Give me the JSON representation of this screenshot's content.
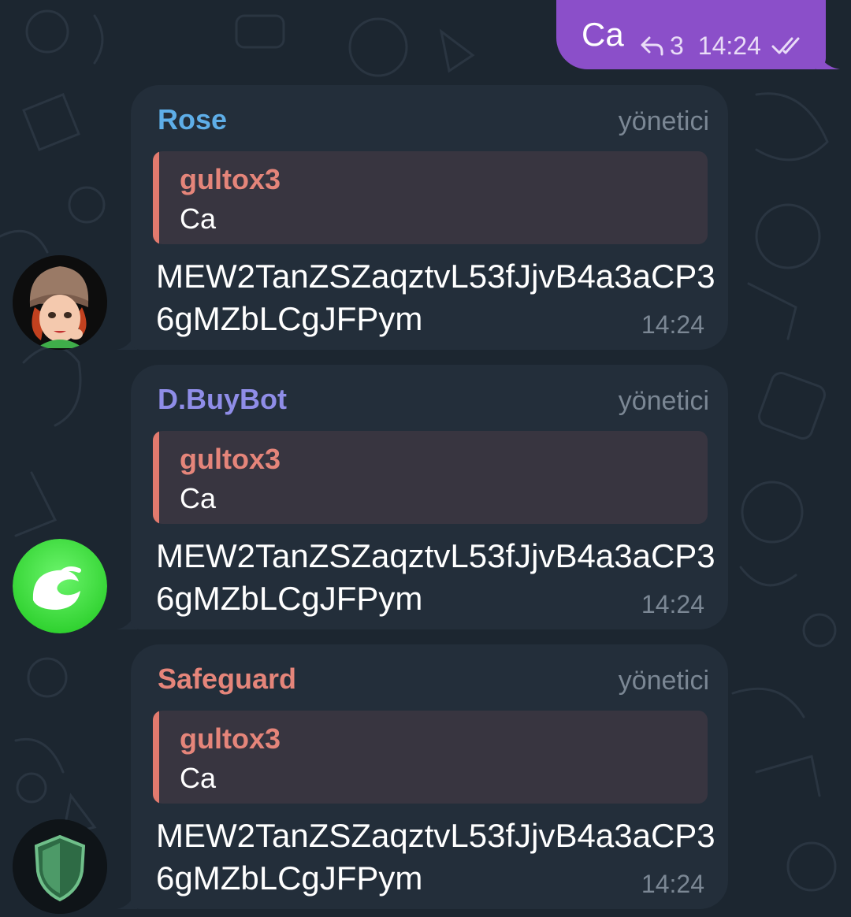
{
  "outgoing": {
    "text": "Ca",
    "reply_count": "3",
    "time": "14:24",
    "color": "#8b4fc9"
  },
  "messages": [
    {
      "sender": "Rose",
      "sender_color": "#5eaee8",
      "role": "yönetici",
      "quote_author": "gultox3",
      "quote_text": "Ca",
      "text": "MEW2TanZSZaqztvL53fJjvB4a3aCP36gMZbLCgJFPym",
      "time": "14:24",
      "avatar": "cartoon-girl-avatar"
    },
    {
      "sender": "D.BuyBot",
      "sender_color": "#8f8de8",
      "role": "yönetici",
      "quote_author": "gultox3",
      "quote_text": "Ca",
      "text": "MEW2TanZSZaqztvL53fJjvB4a3aCP36gMZbLCgJFPym",
      "time": "14:24",
      "avatar": "green-wave-avatar"
    },
    {
      "sender": "Safeguard",
      "sender_color": "#e5857a",
      "role": "yönetici",
      "quote_author": "gultox3",
      "quote_text": "Ca",
      "text": "MEW2TanZSZaqztvL53fJjvB4a3aCP36gMZbLCgJFPym",
      "time": "14:24",
      "avatar": "green-shield-avatar"
    }
  ]
}
